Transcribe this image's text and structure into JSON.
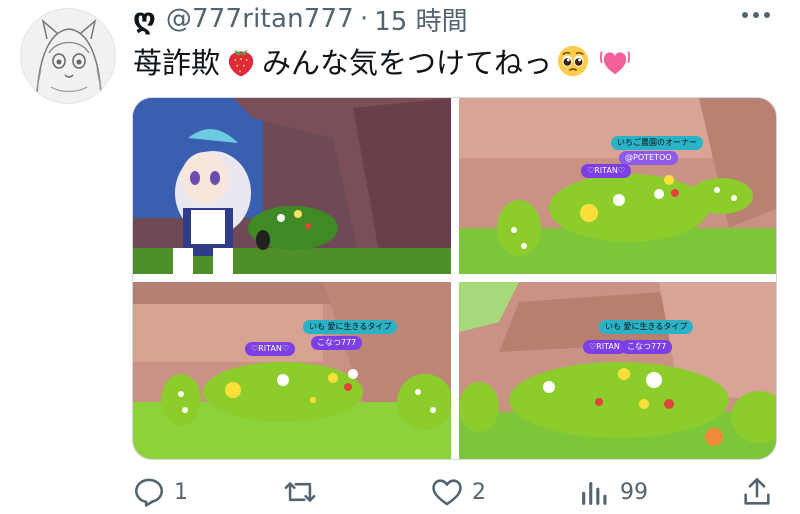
{
  "tweet": {
    "brand_glyph": "ღ",
    "handle": "@777ritan777",
    "separator": "·",
    "time": "15 時間",
    "text_part1": "苺詐欺",
    "text_part2": "みんな気をつけてねっ",
    "emojis": [
      "strawberry-emoji",
      "pleading-face-emoji",
      "growing-heart-emoji"
    ]
  },
  "images": {
    "top_right": {
      "tag_cyan": "いちご農園のオーナー",
      "tag_lav": "@POTETOO",
      "tag_purple": "♡RITAN♡"
    },
    "bottom_left": {
      "tag_cyan": "いも 愛に生きるタイプ",
      "tag_purple_left": "♡RITAN♡",
      "tag_purple_right": "こなつ777"
    },
    "bottom_right": {
      "tag_cyan": "いも 愛に生きるタイプ",
      "tag_purple_left": "♡RITAN",
      "tag_purple_right": "こなつ777"
    }
  },
  "actions": {
    "replies": "1",
    "retweets": "",
    "likes": "2",
    "views": "99"
  },
  "colors": {
    "text_secondary": "#536471",
    "border": "#cfd9de",
    "grass": "#7dc63a",
    "bush": "#8ccd2c",
    "rock": "#c99285"
  }
}
